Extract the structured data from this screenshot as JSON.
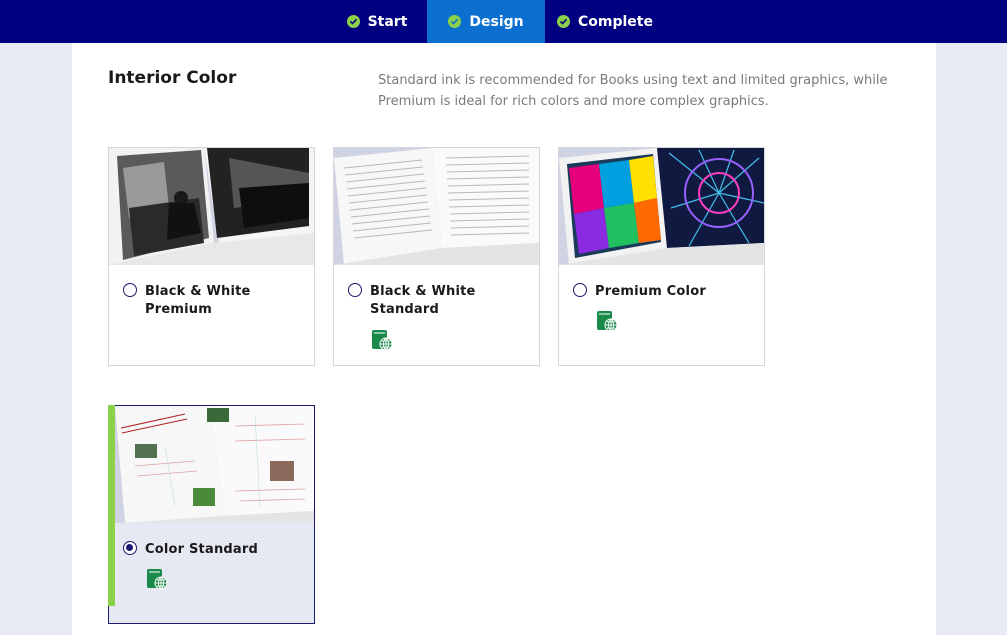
{
  "nav": {
    "steps": [
      {
        "label": "Start",
        "state": "complete"
      },
      {
        "label": "Design",
        "state": "active"
      },
      {
        "label": "Complete",
        "state": "complete"
      }
    ]
  },
  "section": {
    "title": "Interior Color",
    "description": "Standard ink is recommended for Books using text and limited graphics, while Premium is ideal for rich colors and more complex graphics."
  },
  "options": [
    {
      "label": "Black & White Premium",
      "selected": false,
      "icon": "global-distribution-icon",
      "icon_visible": false
    },
    {
      "label": "Black & White Standard",
      "selected": false,
      "icon": "global-distribution-icon",
      "icon_visible": true
    },
    {
      "label": "Premium Color",
      "selected": false,
      "icon": "global-distribution-icon",
      "icon_visible": true
    },
    {
      "label": "Color Standard",
      "selected": true,
      "icon": "global-distribution-icon",
      "icon_visible": true
    }
  ],
  "colors": {
    "nav_bg": "#000080",
    "nav_active": "#0a6fcf",
    "check": "#8cd14a",
    "accent": "#8cd14a",
    "icon_green": "#1a8a4a"
  }
}
